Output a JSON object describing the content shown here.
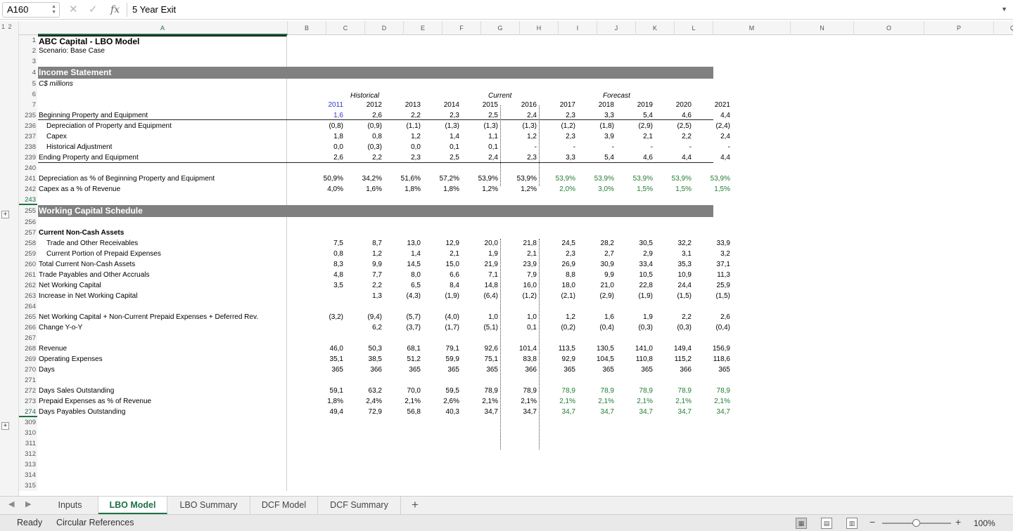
{
  "formula_bar": {
    "name_box": "A160",
    "formula": "5 Year Exit",
    "icons": {
      "cancel": "x-icon",
      "confirm": "check-icon",
      "fx": "fx-icon"
    },
    "fx_label": "fx"
  },
  "outline": {
    "levels": "1 2",
    "expand_symbol": "+"
  },
  "columns": [
    "A",
    "B",
    "C",
    "D",
    "E",
    "F",
    "G",
    "H",
    "I",
    "J",
    "K",
    "L",
    "M",
    "N",
    "O",
    "P",
    "Q"
  ],
  "colors": {
    "blue_input": "#3333cc",
    "green_forecast": "#1e7d32",
    "header_bar": "#808080",
    "accent": "#1e7145"
  },
  "section_labels": {
    "historical": "Historical",
    "current": "Current",
    "forecast": "Forecast"
  },
  "rows": [
    {
      "r": "1",
      "a": "ABC Capital - LBO Model",
      "style": "title"
    },
    {
      "r": "2",
      "a": "Scenario: Base Case"
    },
    {
      "r": "3",
      "a": ""
    },
    {
      "r": "4",
      "a": "Income Statement",
      "style": "bar"
    },
    {
      "r": "5",
      "a": "C$ millions",
      "style": "italic"
    },
    {
      "r": "6",
      "a": "",
      "style": "sections"
    },
    {
      "r": "7",
      "a": "",
      "style": "years",
      "v": [
        "2011",
        "2012",
        "2013",
        "2014",
        "2015",
        "2016",
        "2017",
        "2018",
        "2019",
        "2020",
        "2021"
      ]
    },
    {
      "r": "235",
      "a": "Beginning Property and Equipment",
      "v": [
        "1,6",
        "2,6",
        "2,2",
        "2,3",
        "2,5",
        "2,4",
        "2,3",
        "3,3",
        "5,4",
        "4,6",
        "4,4"
      ]
    },
    {
      "r": "236",
      "a": "Depreciation of Property and Equipment",
      "indent": 1,
      "v": [
        "(0,8)",
        "(0,9)",
        "(1,1)",
        "(1,3)",
        "(1,3)",
        "(1,3)",
        "(1,2)",
        "(1,8)",
        "(2,9)",
        "(2,5)",
        "(2,4)"
      ]
    },
    {
      "r": "237",
      "a": "Capex",
      "indent": 1,
      "v": [
        "1,8",
        "0,8",
        "1,2",
        "1,4",
        "1,1",
        "1,2",
        "2,3",
        "3,9",
        "2,1",
        "2,2",
        "2,4"
      ]
    },
    {
      "r": "238",
      "a": "Historical Adjustment",
      "indent": 1,
      "v": [
        "0,0",
        "(0,3)",
        "0,0",
        "0,1",
        "0,1",
        "-",
        "-",
        "-",
        "-",
        "-",
        "-"
      ]
    },
    {
      "r": "239",
      "a": "Ending Property and Equipment",
      "v": [
        "2,6",
        "2,2",
        "2,3",
        "2,5",
        "2,4",
        "2,3",
        "3,3",
        "5,4",
        "4,6",
        "4,4",
        "4,4"
      ]
    },
    {
      "r": "240",
      "a": ""
    },
    {
      "r": "241",
      "a": "Depreciation as % of Beginning Property and Equipment",
      "v": [
        "50,9%",
        "34,2%",
        "51,6%",
        "57,2%",
        "53,9%",
        "53,9%",
        "53,9%",
        "53,9%",
        "53,9%",
        "53,9%",
        "53,9%"
      ]
    },
    {
      "r": "242",
      "a": "Capex as a % of Revenue",
      "v": [
        "4,0%",
        "1,6%",
        "1,8%",
        "1,8%",
        "1,2%",
        "1,2%",
        "2,0%",
        "3,0%",
        "1,5%",
        "1,5%",
        "1,5%"
      ]
    },
    {
      "r": "243",
      "a": "",
      "style": "selected"
    },
    {
      "r": "255",
      "a": "Working Capital Schedule",
      "style": "bar"
    },
    {
      "r": "256",
      "a": ""
    },
    {
      "r": "257",
      "a": "Current Non-Cash Assets",
      "style": "bold"
    },
    {
      "r": "258",
      "a": "Trade and Other Receivables",
      "indent": 1,
      "v": [
        "7,5",
        "8,7",
        "13,0",
        "12,9",
        "20,0",
        "21,8",
        "24,5",
        "28,2",
        "30,5",
        "32,2",
        "33,9"
      ]
    },
    {
      "r": "259",
      "a": "Current Portion of Prepaid Expenses",
      "indent": 1,
      "v": [
        "0,8",
        "1,2",
        "1,4",
        "2,1",
        "1,9",
        "2,1",
        "2,3",
        "2,7",
        "2,9",
        "3,1",
        "3,2"
      ]
    },
    {
      "r": "260",
      "a": "Total Current Non-Cash Assets",
      "v": [
        "8,3",
        "9,9",
        "14,5",
        "15,0",
        "21,9",
        "23,9",
        "26,9",
        "30,9",
        "33,4",
        "35,3",
        "37,1"
      ]
    },
    {
      "r": "261",
      "a": "Trade Payables and Other Accruals",
      "v": [
        "4,8",
        "7,7",
        "8,0",
        "6,6",
        "7,1",
        "7,9",
        "8,8",
        "9,9",
        "10,5",
        "10,9",
        "11,3"
      ]
    },
    {
      "r": "262",
      "a": "Net Working Capital",
      "v": [
        "3,5",
        "2,2",
        "6,5",
        "8,4",
        "14,8",
        "16,0",
        "18,0",
        "21,0",
        "22,8",
        "24,4",
        "25,9"
      ]
    },
    {
      "r": "263",
      "a": "Increase in Net Working Capital",
      "v": [
        "",
        "1,3",
        "(4,3)",
        "(1,9)",
        "(6,4)",
        "(1,2)",
        "(2,1)",
        "(2,9)",
        "(1,9)",
        "(1,5)",
        "(1,5)"
      ]
    },
    {
      "r": "264",
      "a": ""
    },
    {
      "r": "265",
      "a": "Net Working Capital + Non-Current Prepaid Expenses + Deferred Rev.",
      "v": [
        "(3,2)",
        "(9,4)",
        "(5,7)",
        "(4,0)",
        "1,0",
        "1,0",
        "1,2",
        "1,6",
        "1,9",
        "2,2",
        "2,6"
      ]
    },
    {
      "r": "266",
      "a": "Change Y-o-Y",
      "v": [
        "",
        "6,2",
        "(3,7)",
        "(1,7)",
        "(5,1)",
        "0,1",
        "(0,2)",
        "(0,4)",
        "(0,3)",
        "(0,3)",
        "(0,4)"
      ]
    },
    {
      "r": "267",
      "a": ""
    },
    {
      "r": "268",
      "a": "Revenue",
      "v": [
        "46,0",
        "50,3",
        "68,1",
        "79,1",
        "92,6",
        "101,4",
        "113,5",
        "130,5",
        "141,0",
        "149,4",
        "156,9"
      ]
    },
    {
      "r": "269",
      "a": "Operating Expenses",
      "v": [
        "35,1",
        "38,5",
        "51,2",
        "59,9",
        "75,1",
        "83,8",
        "92,9",
        "104,5",
        "110,8",
        "115,2",
        "118,6"
      ]
    },
    {
      "r": "270",
      "a": "Days",
      "v": [
        "365",
        "366",
        "365",
        "365",
        "365",
        "366",
        "365",
        "365",
        "365",
        "366",
        "365"
      ]
    },
    {
      "r": "271",
      "a": ""
    },
    {
      "r": "272",
      "a": "Days Sales Outstanding",
      "v": [
        "59,1",
        "63,2",
        "70,0",
        "59,5",
        "78,9",
        "78,9",
        "78,9",
        "78,9",
        "78,9",
        "78,9",
        "78,9"
      ]
    },
    {
      "r": "273",
      "a": "Prepaid Expenses as % of Revenue",
      "v": [
        "1,8%",
        "2,4%",
        "2,1%",
        "2,6%",
        "2,1%",
        "2,1%",
        "2,1%",
        "2,1%",
        "2,1%",
        "2,1%",
        "2,1%"
      ]
    },
    {
      "r": "274",
      "a": "Days Payables Outstanding",
      "style": "selected",
      "v": [
        "49,4",
        "72,9",
        "56,8",
        "40,3",
        "34,7",
        "34,7",
        "34,7",
        "34,7",
        "34,7",
        "34,7",
        "34,7"
      ]
    },
    {
      "r": "309",
      "a": ""
    },
    {
      "r": "310",
      "a": ""
    },
    {
      "r": "311",
      "a": ""
    },
    {
      "r": "312",
      "a": ""
    },
    {
      "r": "313",
      "a": ""
    },
    {
      "r": "314",
      "a": ""
    },
    {
      "r": "315",
      "a": ""
    }
  ],
  "green_rows": [
    "241",
    "242",
    "272",
    "273",
    "274"
  ],
  "sheet_tabs": [
    "Inputs",
    "LBO Model",
    "LBO Summary",
    "DCF Model",
    "DCF Summary"
  ],
  "active_tab": "LBO Model",
  "add_sheet": "+",
  "status": {
    "ready": "Ready",
    "circular": "Circular References",
    "zoom": "100%",
    "zoom_fraction": 0.5
  }
}
